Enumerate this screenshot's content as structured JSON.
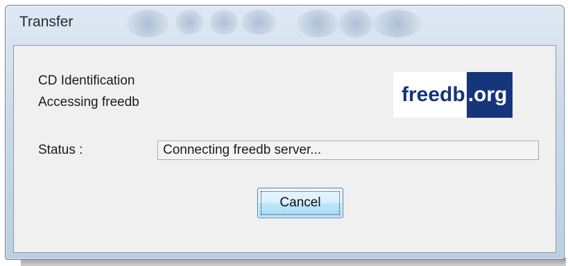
{
  "window": {
    "title": "Transfer"
  },
  "content": {
    "heading": "CD Identification",
    "subheading": "Accessing freedb",
    "logo": {
      "left_text": "freedb",
      "right_text": ".org",
      "colors": {
        "brand_blue": "#16357a",
        "white": "#ffffff"
      }
    },
    "status_label": "Status :",
    "status_value": "Connecting freedb server...",
    "cancel_label": "Cancel"
  }
}
